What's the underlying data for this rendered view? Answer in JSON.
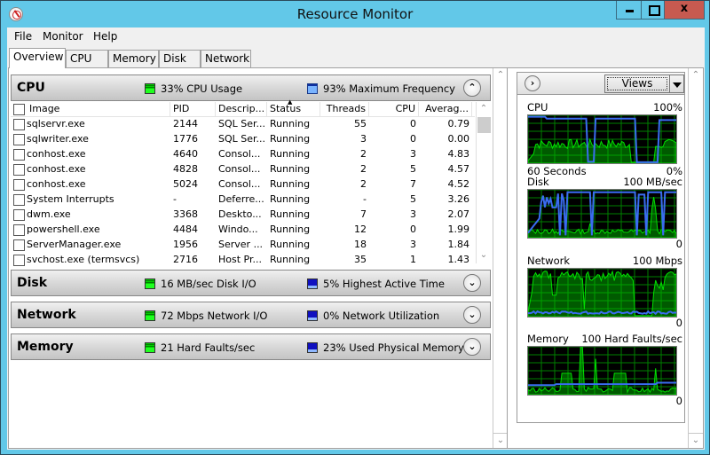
{
  "window": {
    "title": "Resource Monitor",
    "controls": {
      "minimize": "minimize",
      "maximize": "maximize",
      "close": "x"
    }
  },
  "menu": [
    "File",
    "Monitor",
    "Help"
  ],
  "tabs": [
    {
      "label": "Overview",
      "active": true
    },
    {
      "label": "CPU",
      "active": false
    },
    {
      "label": "Memory",
      "active": false
    },
    {
      "label": "Disk",
      "active": false
    },
    {
      "label": "Network",
      "active": false
    }
  ],
  "sections": {
    "cpu": {
      "title": "CPU",
      "metric1": "33% CPU Usage",
      "metric2": "93% Maximum Frequency",
      "expanded": true,
      "columns": [
        "Image",
        "PID",
        "Descrip...",
        "Status",
        "Threads",
        "CPU",
        "Averag..."
      ],
      "sort_column": "Status",
      "rows": [
        {
          "image": "sqlservr.exe",
          "pid": "2144",
          "desc": "SQL Ser...",
          "status": "Running",
          "threads": "55",
          "cpu": "0",
          "avg": "0.79"
        },
        {
          "image": "sqlwriter.exe",
          "pid": "1776",
          "desc": "SQL Ser...",
          "status": "Running",
          "threads": "3",
          "cpu": "0",
          "avg": "0.00"
        },
        {
          "image": "conhost.exe",
          "pid": "4640",
          "desc": "Consol...",
          "status": "Running",
          "threads": "2",
          "cpu": "3",
          "avg": "4.83"
        },
        {
          "image": "conhost.exe",
          "pid": "4828",
          "desc": "Consol...",
          "status": "Running",
          "threads": "2",
          "cpu": "5",
          "avg": "4.57"
        },
        {
          "image": "conhost.exe",
          "pid": "5024",
          "desc": "Consol...",
          "status": "Running",
          "threads": "2",
          "cpu": "7",
          "avg": "4.52"
        },
        {
          "image": "System Interrupts",
          "pid": "-",
          "desc": "Deferre...",
          "status": "Running",
          "threads": "-",
          "cpu": "5",
          "avg": "3.26"
        },
        {
          "image": "dwm.exe",
          "pid": "3368",
          "desc": "Deskto...",
          "status": "Running",
          "threads": "7",
          "cpu": "3",
          "avg": "2.07"
        },
        {
          "image": "powershell.exe",
          "pid": "4484",
          "desc": "Windo...",
          "status": "Running",
          "threads": "12",
          "cpu": "0",
          "avg": "1.99"
        },
        {
          "image": "ServerManager.exe",
          "pid": "1956",
          "desc": "Server ...",
          "status": "Running",
          "threads": "18",
          "cpu": "3",
          "avg": "1.84"
        },
        {
          "image": "svchost.exe (termsvcs)",
          "pid": "2716",
          "desc": "Host Pr...",
          "status": "Running",
          "threads": "35",
          "cpu": "1",
          "avg": "1.43"
        }
      ]
    },
    "disk": {
      "title": "Disk",
      "metric1": "16 MB/sec Disk I/O",
      "metric2": "5% Highest Active Time",
      "expanded": false
    },
    "network": {
      "title": "Network",
      "metric1": "72 Mbps Network I/O",
      "metric2": "0% Network Utilization",
      "expanded": false
    },
    "memory": {
      "title": "Memory",
      "metric1": "21 Hard Faults/sec",
      "metric2": "23% Used Physical Memory",
      "expanded": false
    }
  },
  "right_panel": {
    "views_label": "Views",
    "graphs": [
      {
        "name": "CPU",
        "max": "100%",
        "min": "0%",
        "time": "60 Seconds"
      },
      {
        "name": "Disk",
        "max": "100 MB/sec",
        "min": "0"
      },
      {
        "name": "Network",
        "max": "100 Mbps",
        "min": "0"
      },
      {
        "name": "Memory",
        "max": "100 Hard Faults/sec",
        "min": "0"
      }
    ]
  },
  "colors": {
    "titlebar": "#62c8e8",
    "close_button": "#c75a50",
    "graph_green": "#00e000",
    "graph_blue": "#3a6cf0",
    "graph_grid": "#008000"
  }
}
